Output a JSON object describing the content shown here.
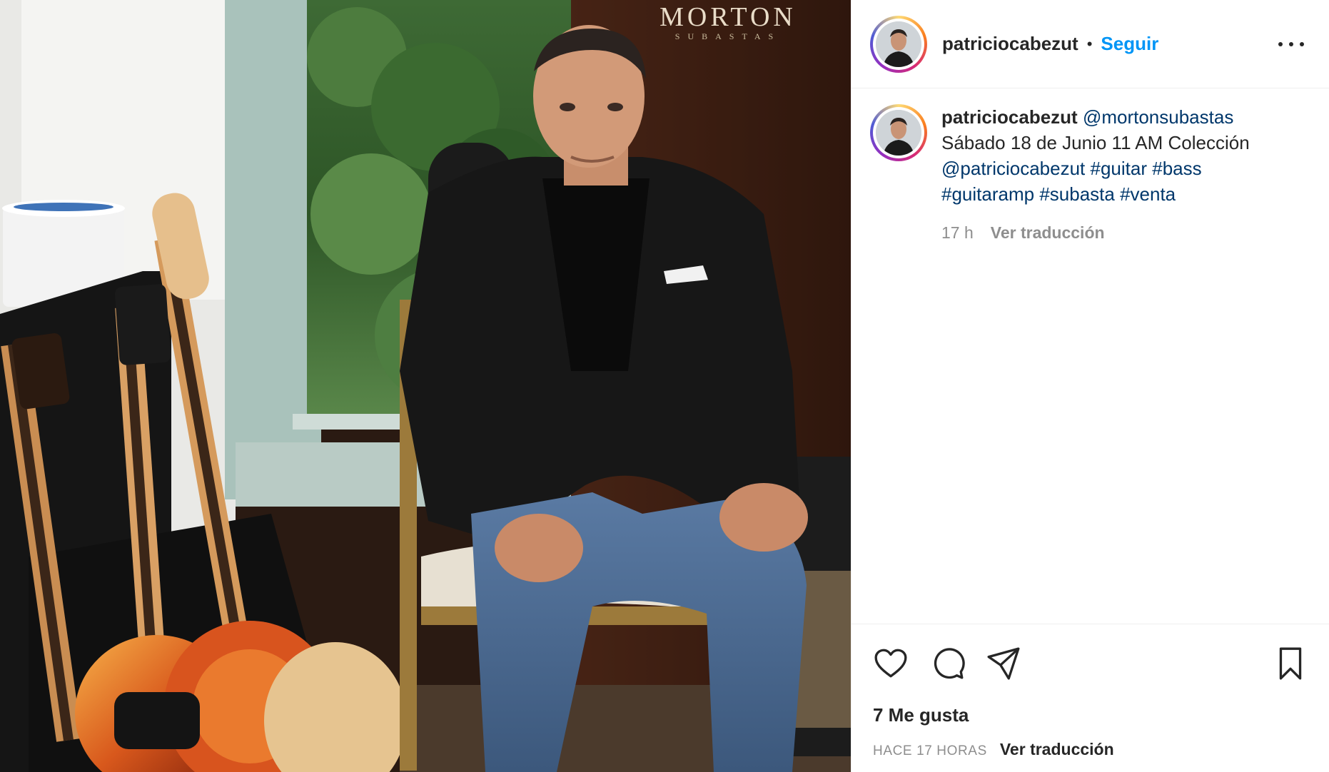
{
  "photo": {
    "brand_name": "MORTON",
    "brand_sub": "SUBASTAS"
  },
  "header": {
    "username": "patriciocabezut",
    "separator": "•",
    "follow_label": "Seguir"
  },
  "caption": {
    "username": "patriciocabezut",
    "mention_1": "@mortonsubastas",
    "text": "Sábado 18 de Junio 11 AM Colección",
    "mention_2": "@patriciocabezut",
    "tags": [
      "#guitar",
      "#bass",
      "#guitaramp",
      "#subasta",
      "#venta"
    ],
    "time": "17 h",
    "translate_label": "Ver traducción"
  },
  "actions": {
    "likes_text": "7 Me gusta",
    "time_ago": "HACE 17 HORAS",
    "translate_label": "Ver traducción"
  },
  "icons": {
    "like": "heart-icon",
    "comment": "comment-icon",
    "share": "paper-plane-icon",
    "save": "bookmark-icon",
    "more": "more-options-icon"
  },
  "colors": {
    "follow_blue": "#0095f6",
    "link_navy": "#00376b",
    "muted_gray": "#8e8e8e",
    "text": "#262626"
  }
}
